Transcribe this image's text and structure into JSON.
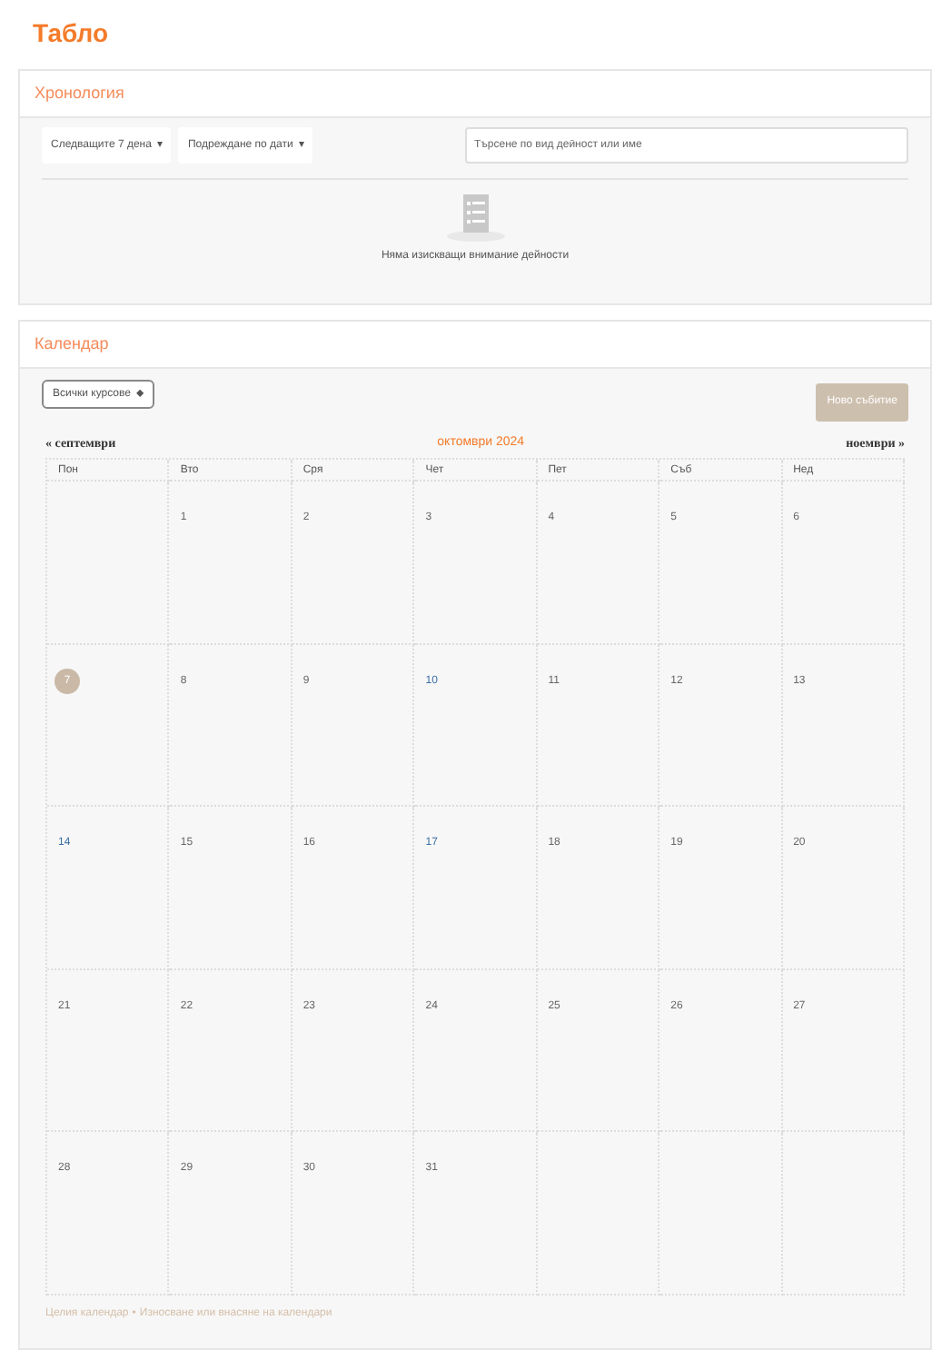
{
  "page_title": "Табло",
  "timeline": {
    "title": "Хронология",
    "filters": [
      {
        "label": "Следващите 7 дена",
        "caret": "▾"
      },
      {
        "label": "Подреждане по дати",
        "caret": "▾"
      }
    ],
    "search": {
      "placeholder": "Търсене по вид дейност или име"
    },
    "empty_message": "Няма изискващи внимание дейности"
  },
  "calendar": {
    "title": "Календар",
    "course_select": {
      "label": "Всички курсове",
      "caret": "⬥"
    },
    "new_event_button": "Ново събитие",
    "prev": {
      "arrow": "«",
      "label": "септември"
    },
    "month": "октомври 2024",
    "next": {
      "label": "ноември",
      "arrow": "»"
    },
    "weekdays": [
      "Пон",
      "Вто",
      "Сря",
      "Чет",
      "Пет",
      "Съб",
      "Нед"
    ],
    "weeks": [
      [
        {
          "day": "1",
          "today": false,
          "linked": false
        },
        {
          "day": "2",
          "today": false,
          "linked": false
        },
        {
          "day": "3",
          "today": false,
          "linked": false
        },
        {
          "day": "4",
          "today": false,
          "linked": false
        },
        {
          "day": "5",
          "today": false,
          "linked": false
        },
        {
          "day": "6",
          "today": false,
          "linked": false
        }
      ],
      [
        {
          "day": "7",
          "today": true,
          "linked": false
        },
        {
          "day": "8",
          "today": false,
          "linked": false
        },
        {
          "day": "9",
          "today": false,
          "linked": false
        },
        {
          "day": "10",
          "today": false,
          "linked": true
        },
        {
          "day": "11",
          "today": false,
          "linked": false
        },
        {
          "day": "12",
          "today": false,
          "linked": false
        },
        {
          "day": "13",
          "today": false,
          "linked": false
        }
      ],
      [
        {
          "day": "14",
          "today": false,
          "linked": true
        },
        {
          "day": "15",
          "today": false,
          "linked": false
        },
        {
          "day": "16",
          "today": false,
          "linked": false
        },
        {
          "day": "17",
          "today": false,
          "linked": true
        },
        {
          "day": "18",
          "today": false,
          "linked": false
        },
        {
          "day": "19",
          "today": false,
          "linked": false
        },
        {
          "day": "20",
          "today": false,
          "linked": false
        }
      ],
      [
        {
          "day": "21",
          "today": false,
          "linked": false
        },
        {
          "day": "22",
          "today": false,
          "linked": false
        },
        {
          "day": "23",
          "today": false,
          "linked": false
        },
        {
          "day": "24",
          "today": false,
          "linked": false
        },
        {
          "day": "25",
          "today": false,
          "linked": false
        },
        {
          "day": "26",
          "today": false,
          "linked": false
        },
        {
          "day": "27",
          "today": false,
          "linked": false
        }
      ],
      [
        {
          "day": "28",
          "today": false,
          "linked": false
        },
        {
          "day": "29",
          "today": false,
          "linked": false
        },
        {
          "day": "30",
          "today": false,
          "linked": false
        },
        {
          "day": "31",
          "today": false,
          "linked": false
        }
      ]
    ],
    "footer_links": [
      "Целия календар",
      "Износване или внасяне на календари"
    ],
    "footer_separator": "•"
  }
}
